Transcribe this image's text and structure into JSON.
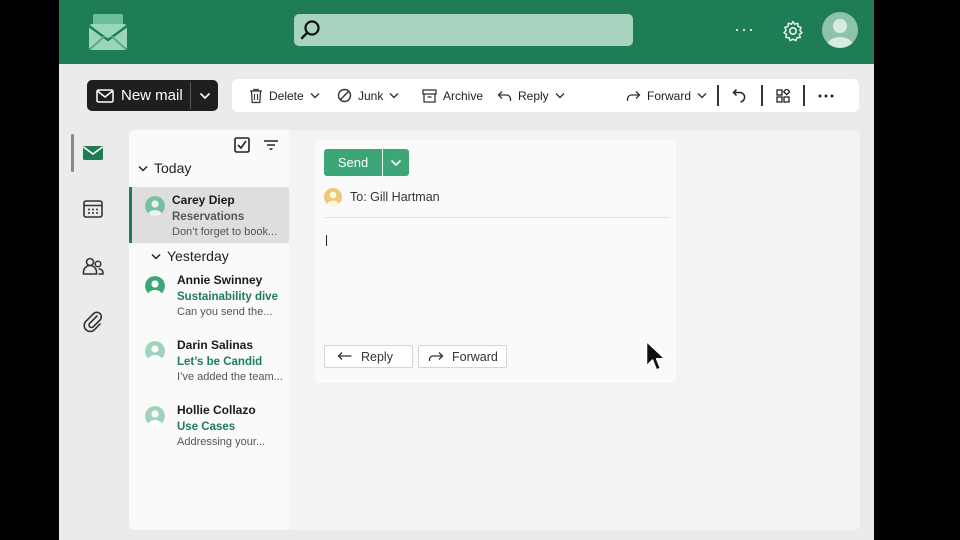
{
  "app": {
    "brand_color": "#1e7d55",
    "accent_color": "#3da676"
  },
  "header": {
    "search_placeholder": "",
    "more_label": "···"
  },
  "toolbar": {
    "new_mail_label": "New mail",
    "delete_label": "Delete",
    "junk_label": "Junk",
    "archive_label": "Archive",
    "reply_label": "Reply",
    "forward_label": "Forward"
  },
  "rail": {
    "items": [
      "mail-icon",
      "calendar-icon",
      "people-icon",
      "attachment-icon"
    ],
    "active": "mail-icon"
  },
  "list": {
    "groups": {
      "today": "Today",
      "yesterday": "Yesterday"
    },
    "messages": [
      {
        "from": "Carey Diep",
        "subject": "Reservations",
        "preview": "Don’t forget to book...",
        "selected": true,
        "group": "today"
      },
      {
        "from": "Annie Swinney",
        "subject": "Sustainability dive",
        "preview": "Can you send the...",
        "selected": false,
        "group": "yesterday"
      },
      {
        "from": "Darin Salinas",
        "subject": "Let’s be Candid",
        "preview": "I’ve added the team...",
        "selected": false,
        "group": "yesterday"
      },
      {
        "from": "Hollie Collazo",
        "subject": "Use Cases",
        "preview": "Addressing your...",
        "selected": false,
        "group": "yesterday"
      }
    ]
  },
  "compose": {
    "send_label": "Send",
    "to_text": "To: Gill Hartman",
    "reply_label": "Reply",
    "forward_label": "Forward"
  }
}
